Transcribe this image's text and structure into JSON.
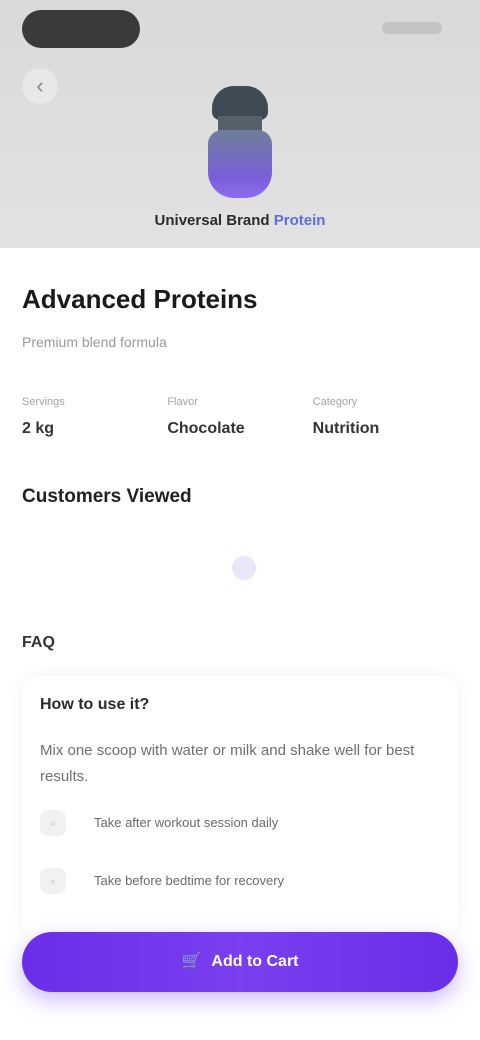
{
  "hero": {
    "back_icon": "chevron-left-icon",
    "caption_dark": "Universal Brand",
    "caption_accent": "Protein"
  },
  "product": {
    "title": "Advanced Proteins",
    "subtitle": "Premium blend formula"
  },
  "stats": [
    {
      "label": "Servings",
      "value": "2 kg"
    },
    {
      "label": "Flavor",
      "value": "Chocolate"
    },
    {
      "label": "Category",
      "value": "Nutrition"
    }
  ],
  "sections": {
    "recommended": "Customers Viewed",
    "faq": "FAQ"
  },
  "faq": {
    "question": "How to use it?",
    "answer": "Mix one scoop with water or milk and shake well for best results.",
    "options": [
      {
        "icon": "cup-icon",
        "text": "Take after workout session daily"
      },
      {
        "icon": "clock-icon",
        "text": "Take before bedtime for recovery"
      }
    ]
  },
  "cta": {
    "label": "Add to Cart",
    "icon": "cart-icon"
  },
  "colors": {
    "accent": "#6a2ee8",
    "caption_accent": "#5b6ee0"
  }
}
